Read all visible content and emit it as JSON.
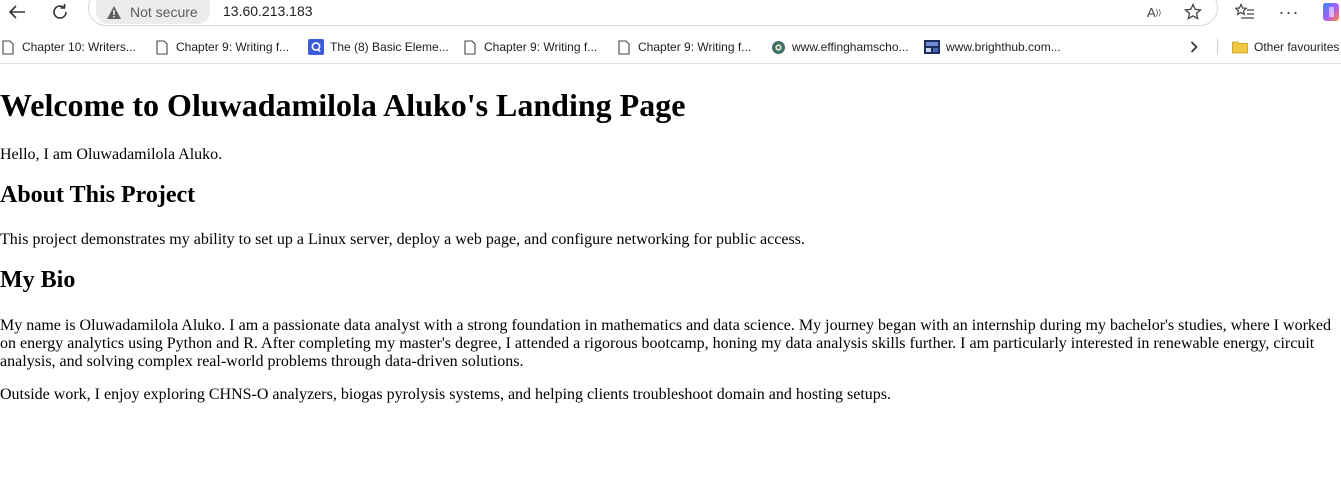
{
  "browser": {
    "security_label": "Not secure",
    "url": "13.60.213.183"
  },
  "bookmarks": [
    {
      "label": "Chapter 10: Writers...",
      "icon": "page-icon"
    },
    {
      "label": "Chapter 9: Writing f...",
      "icon": "page-icon"
    },
    {
      "label": "The (8) Basic Eleme...",
      "icon": "site-q-icon"
    },
    {
      "label": "Chapter 9: Writing f...",
      "icon": "page-icon"
    },
    {
      "label": "Chapter 9: Writing f...",
      "icon": "page-icon"
    },
    {
      "label": "www.effinghamscho...",
      "icon": "globe-icon"
    },
    {
      "label": "www.brighthub.com...",
      "icon": "site-image-icon"
    }
  ],
  "other_favourites": "Other favourites",
  "page": {
    "title": "Welcome to Oluwadamilola Aluko's Landing Page",
    "intro": "Hello, I am Oluwadamilola Aluko.",
    "about_heading": "About This Project",
    "about_text": "This project demonstrates my ability to set up a Linux server, deploy a web page, and configure networking for public access.",
    "bio_heading": "My Bio",
    "bio_text": "My name is Oluwadamilola Aluko. I am a passionate data analyst with a strong foundation in mathematics and data science. My journey began with an internship during my bachelor's studies, where I worked on energy analytics using Python and R. After completing my master's degree, I attended a rigorous bootcamp, honing my data analysis skills further. I am particularly interested in renewable energy, circuit analysis, and solving complex real-world problems through data-driven solutions.",
    "outside_text": "Outside work, I enjoy exploring CHNS-O analyzers, biogas pyrolysis systems, and helping clients troubleshoot domain and hosting setups."
  },
  "colors": {
    "accent": "#3b5bdb",
    "folder": "#f2c744"
  }
}
